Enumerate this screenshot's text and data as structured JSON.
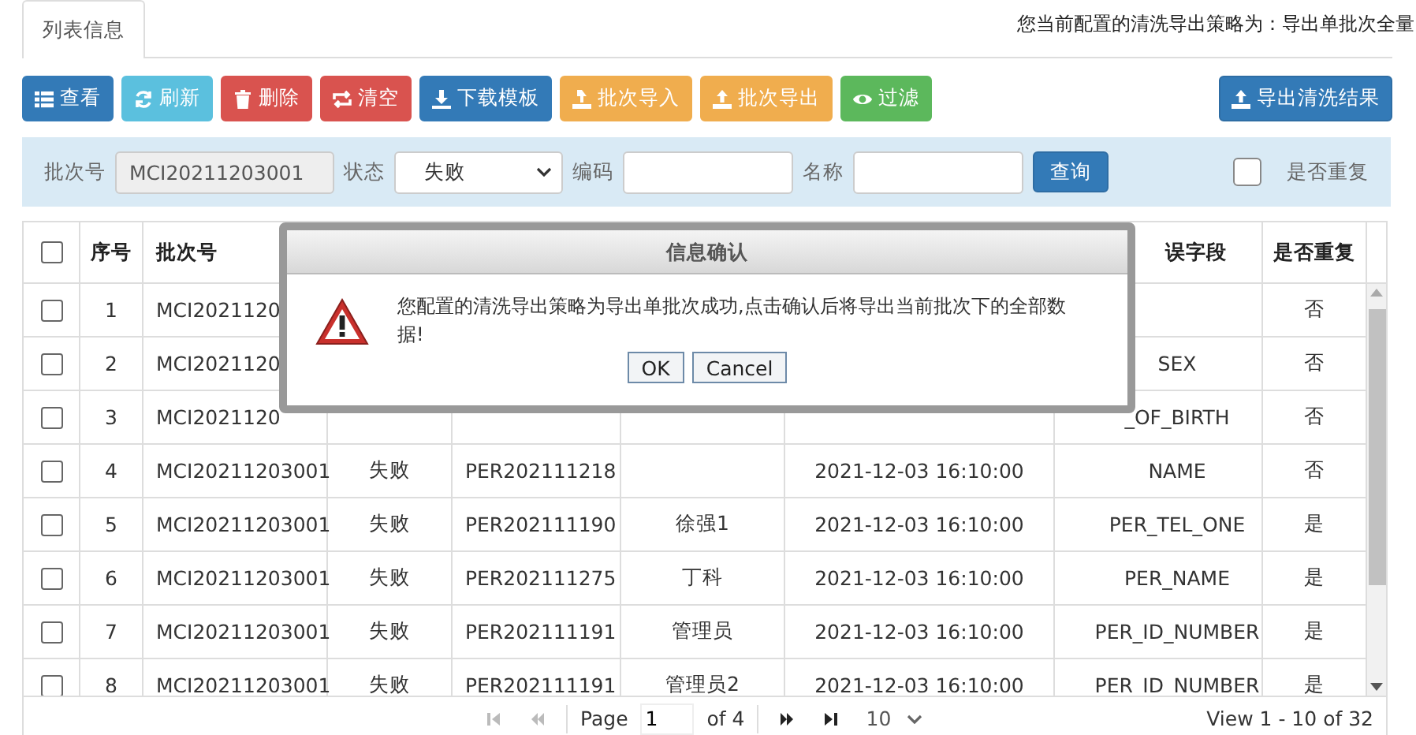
{
  "tabs": [
    {
      "label": "列表信息",
      "selected": true
    }
  ],
  "strategy_note": "您当前配置的清洗导出策略为：导出单批次全量",
  "toolbar": [
    {
      "label": "查看",
      "color": "#337ab7"
    },
    {
      "label": "刷新",
      "color": "#5bc0de"
    },
    {
      "label": "删除",
      "color": "#d9534f"
    },
    {
      "label": "清空",
      "color": "#d9534f"
    },
    {
      "label": "下载模板",
      "color": "#337ab7"
    },
    {
      "label": "批次导入",
      "color": "#f0ad4e"
    },
    {
      "label": "批次导出",
      "color": "#f0ad4e"
    },
    {
      "label": "过滤",
      "color": "#5cb85c"
    }
  ],
  "export_button": {
    "label": "导出清洗结果"
  },
  "filter": {
    "batch_label": "批次号",
    "batch_value": "MCI20211203001",
    "status_label": "状态",
    "status_value": "失败",
    "code_label": "编码",
    "name_label": "名称",
    "query_button": "查询",
    "duplicate_checked": false,
    "duplicate_label": "是否重复"
  },
  "table": {
    "header_checked": false,
    "columns": {
      "column_1": "序号",
      "column_2": "批次号",
      "column_7": "误字段",
      "column_8": "是否重复"
    },
    "rows": [
      {
        "checked": false,
        "column_1": "1",
        "column_2": "MCI2021120",
        "column_8": "否"
      },
      {
        "checked": false,
        "column_1": "2",
        "column_2": "MCI2021120",
        "column_7": "SEX",
        "column_8": "否"
      },
      {
        "checked": false,
        "column_1": "3",
        "column_2": "MCI2021120",
        "column_7": "_OF_BIRTH",
        "column_8": "否"
      },
      {
        "checked": false,
        "column_1": "4",
        "column_2": "MCI20211203001",
        "column_3": "失败",
        "column_4": "PER202111218",
        "column_6": "2021-12-03 16:10:00",
        "column_7": "NAME",
        "column_8": "否"
      },
      {
        "checked": false,
        "column_1": "5",
        "column_2": "MCI20211203001",
        "column_3": "失败",
        "column_4": "PER202111190",
        "column_5": "徐强1",
        "column_6": "2021-12-03 16:10:00",
        "column_7": "PER_TEL_ONE",
        "column_8": "是"
      },
      {
        "checked": false,
        "column_1": "6",
        "column_2": "MCI20211203001",
        "column_3": "失败",
        "column_4": "PER202111275",
        "column_5": "丁科",
        "column_6": "2021-12-03 16:10:00",
        "column_7": "PER_NAME",
        "column_8": "是"
      },
      {
        "checked": false,
        "column_1": "7",
        "column_2": "MCI20211203001",
        "column_3": "失败",
        "column_4": "PER202111191",
        "column_5": "管理员",
        "column_6": "2021-12-03 16:10:00",
        "column_7": "PER_ID_NUMBER",
        "column_8": "是"
      },
      {
        "checked": false,
        "column_1": "8",
        "column_2": "MCI20211203001",
        "column_3": "失败",
        "column_4": "PER202111191",
        "column_5": "管理员2",
        "column_6": "2021-12-03 16:10:00",
        "column_7": "PER_ID_NUMBER",
        "column_8": "是"
      }
    ]
  },
  "pager": {
    "page_label": "Page",
    "page_value": "1",
    "of_label": "of 4",
    "page_size": "10",
    "summary": "View 1 - 10 of 32"
  },
  "dialog": {
    "title": "信息确认",
    "message": "您配置的清洗导出策略为导出单批次成功,点击确认后将导出当前批次下的全部数据!",
    "buttons": [
      "OK",
      "Cancel"
    ]
  }
}
